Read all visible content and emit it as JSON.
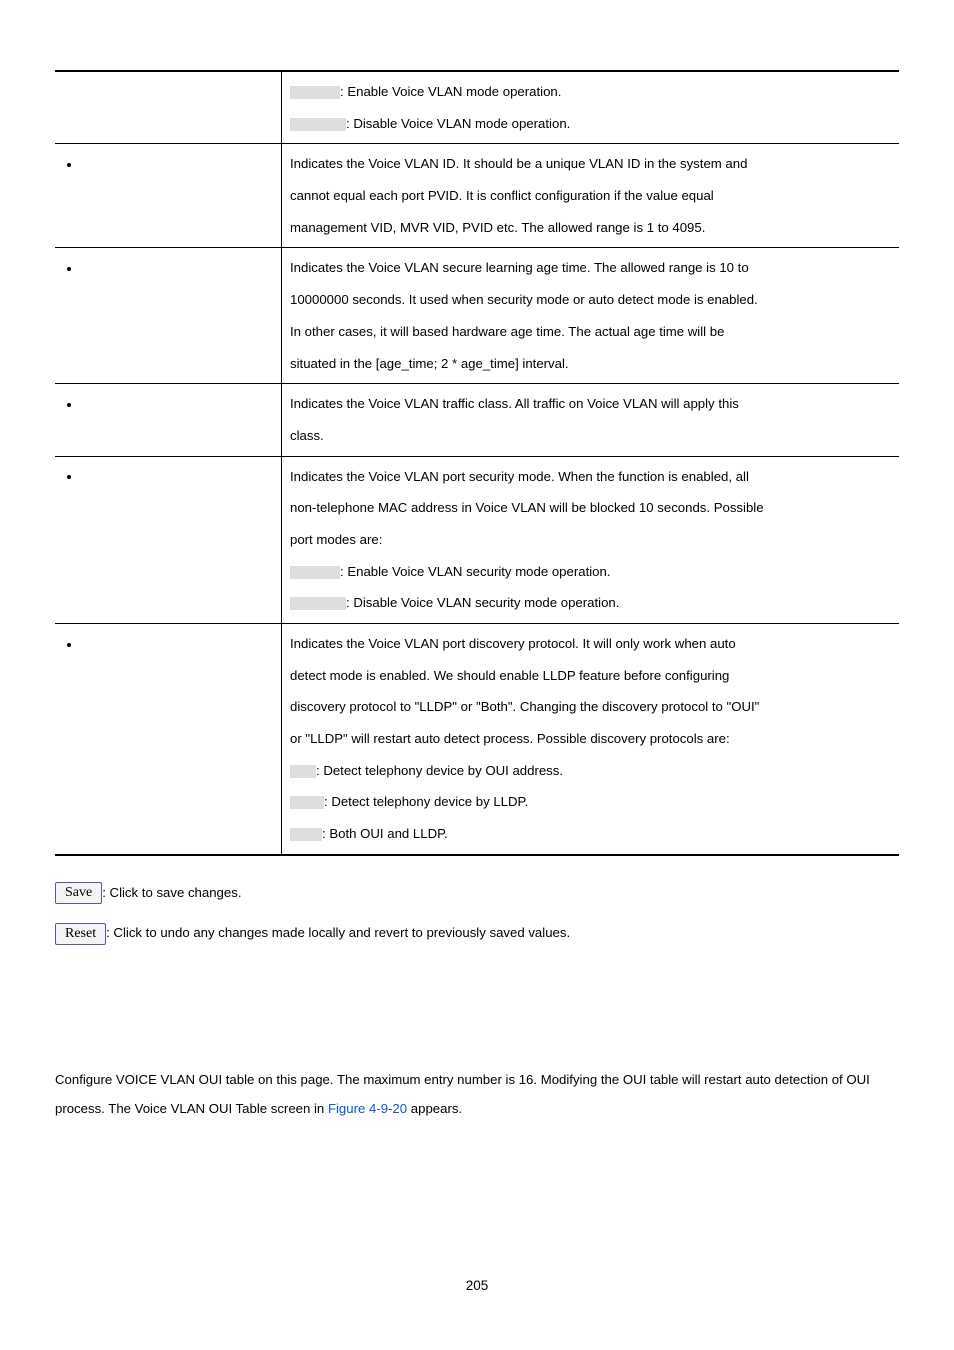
{
  "rows": [
    {
      "left_bullet": false,
      "lines": [
        {
          "label_width": "w-enabled",
          "text": ": Enable Voice VLAN mode operation."
        },
        {
          "label_width": "w-disabled",
          "text": ": Disable Voice VLAN mode operation."
        }
      ]
    },
    {
      "left_bullet": true,
      "lines": [
        {
          "text": "Indicates the Voice VLAN ID. It should be a unique VLAN ID in the system and"
        },
        {
          "text": "cannot equal each port PVID. It is conflict configuration if the value equal"
        },
        {
          "text": "management VID, MVR VID, PVID etc. The allowed range is 1 to 4095."
        }
      ]
    },
    {
      "left_bullet": true,
      "lines": [
        {
          "text": "Indicates the Voice VLAN secure learning age time. The allowed range is 10 to"
        },
        {
          "text": "10000000 seconds. It used when security mode or auto detect mode is enabled."
        },
        {
          "text": "In other cases, it will based hardware age time. The actual age time will be"
        },
        {
          "text": "situated in the [age_time; 2 * age_time] interval."
        }
      ]
    },
    {
      "left_bullet": true,
      "lines": [
        {
          "text": "Indicates the Voice VLAN traffic class. All traffic on Voice VLAN will apply this"
        },
        {
          "text": "class."
        }
      ]
    },
    {
      "left_bullet": true,
      "lines": [
        {
          "text": "Indicates the Voice VLAN port security mode. When the function is enabled, all"
        },
        {
          "text": "non-telephone MAC address in Voice VLAN will be blocked 10 seconds. Possible"
        },
        {
          "text": "port modes are:"
        },
        {
          "label_width": "w-enabled",
          "text": ": Enable Voice VLAN security mode operation."
        },
        {
          "label_width": "w-disabled",
          "text": ": Disable Voice VLAN security mode operation."
        }
      ]
    },
    {
      "left_bullet": true,
      "lines": [
        {
          "text": "Indicates the Voice VLAN port discovery protocol. It will only work when auto"
        },
        {
          "text": "detect mode is enabled. We should enable LLDP feature before configuring"
        },
        {
          "text": "discovery protocol to \"LLDP\" or \"Both\". Changing the discovery protocol to \"OUI\""
        },
        {
          "text": "or \"LLDP\" will restart auto detect process. Possible discovery protocols are:"
        },
        {
          "label_width": "w-oui",
          "text": ": Detect telephony device by OUI address."
        },
        {
          "label_width": "w-lldp",
          "text": ": Detect telephony device by LLDP."
        },
        {
          "label_width": "w-both",
          "text": ": Both OUI and LLDP."
        }
      ]
    }
  ],
  "buttons": {
    "save": {
      "label": "Save",
      "desc": ": Click to save changes."
    },
    "reset": {
      "label": "Reset",
      "desc": ": Click to undo any changes made locally and revert to previously saved values."
    }
  },
  "paragraph": {
    "pre": "Configure VOICE VLAN OUI table on this page. The maximum entry number is 16. Modifying the OUI table will restart auto detection of OUI process. The Voice VLAN OUI Table screen in ",
    "figref": "Figure 4-9-20",
    "post": " appears."
  },
  "page_number": "205"
}
